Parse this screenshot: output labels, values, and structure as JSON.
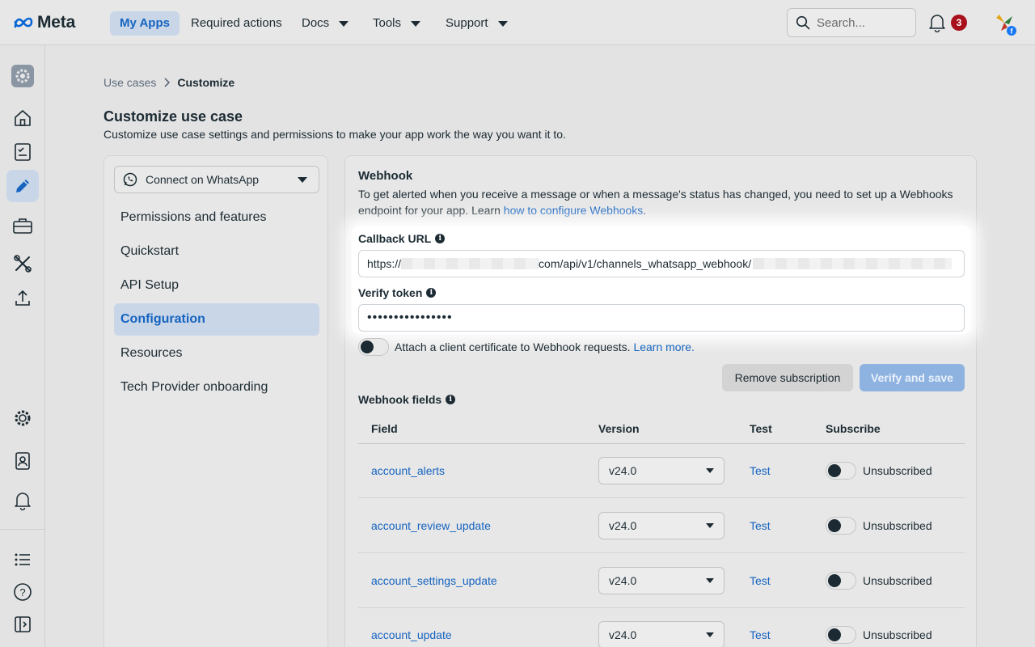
{
  "nav": {
    "brand": "Meta",
    "items": [
      {
        "label": "My Apps",
        "active": true
      },
      {
        "label": "Required actions"
      },
      {
        "label": "Docs",
        "dropdown": true
      },
      {
        "label": "Tools",
        "dropdown": true
      },
      {
        "label": "Support",
        "dropdown": true
      }
    ],
    "search_placeholder": "Search...",
    "notification_count": "3"
  },
  "breadcrumb": {
    "parent": "Use cases",
    "current": "Customize"
  },
  "page": {
    "title": "Customize use case",
    "subtitle": "Customize use case settings and permissions to make your app work the way you want it to."
  },
  "sidebar": {
    "use_case": "Connect on WhatsApp",
    "items": [
      "Permissions and features",
      "Quickstart",
      "API Setup",
      "Configuration",
      "Resources",
      "Tech Provider onboarding"
    ],
    "active_index": 3
  },
  "webhook": {
    "title": "Webhook",
    "desc_prefix": "To get alerted when you receive a message or when a message's status has changed, you need to set up a Webhooks endpoint for your app. Learn ",
    "desc_link": "how to configure Webhooks",
    "desc_suffix": ".",
    "callback_label": "Callback URL",
    "callback_prefix": "https://",
    "callback_mid": "com/api/v1/channels_whatsapp_webhook/",
    "verify_label": "Verify token",
    "verify_value": "••••••••••••••••",
    "cert_text": "Attach a client certificate to Webhook requests. ",
    "cert_link": "Learn more.",
    "remove_label": "Remove subscription",
    "verify_save_label": "Verify and save"
  },
  "webhook_fields": {
    "label": "Webhook fields",
    "headers": {
      "field": "Field",
      "version": "Version",
      "test": "Test",
      "subscribe": "Subscribe"
    },
    "rows": [
      {
        "field": "account_alerts",
        "version": "v24.0",
        "test": "Test",
        "status": "Unsubscribed"
      },
      {
        "field": "account_review_update",
        "version": "v24.0",
        "test": "Test",
        "status": "Unsubscribed"
      },
      {
        "field": "account_settings_update",
        "version": "v24.0",
        "test": "Test",
        "status": "Unsubscribed"
      },
      {
        "field": "account_update",
        "version": "v24.0",
        "test": "Test",
        "status": "Unsubscribed"
      }
    ]
  },
  "colors": {
    "accent": "#1664c0",
    "active_bg": "#c9d6e8",
    "badge": "#a8111c"
  }
}
